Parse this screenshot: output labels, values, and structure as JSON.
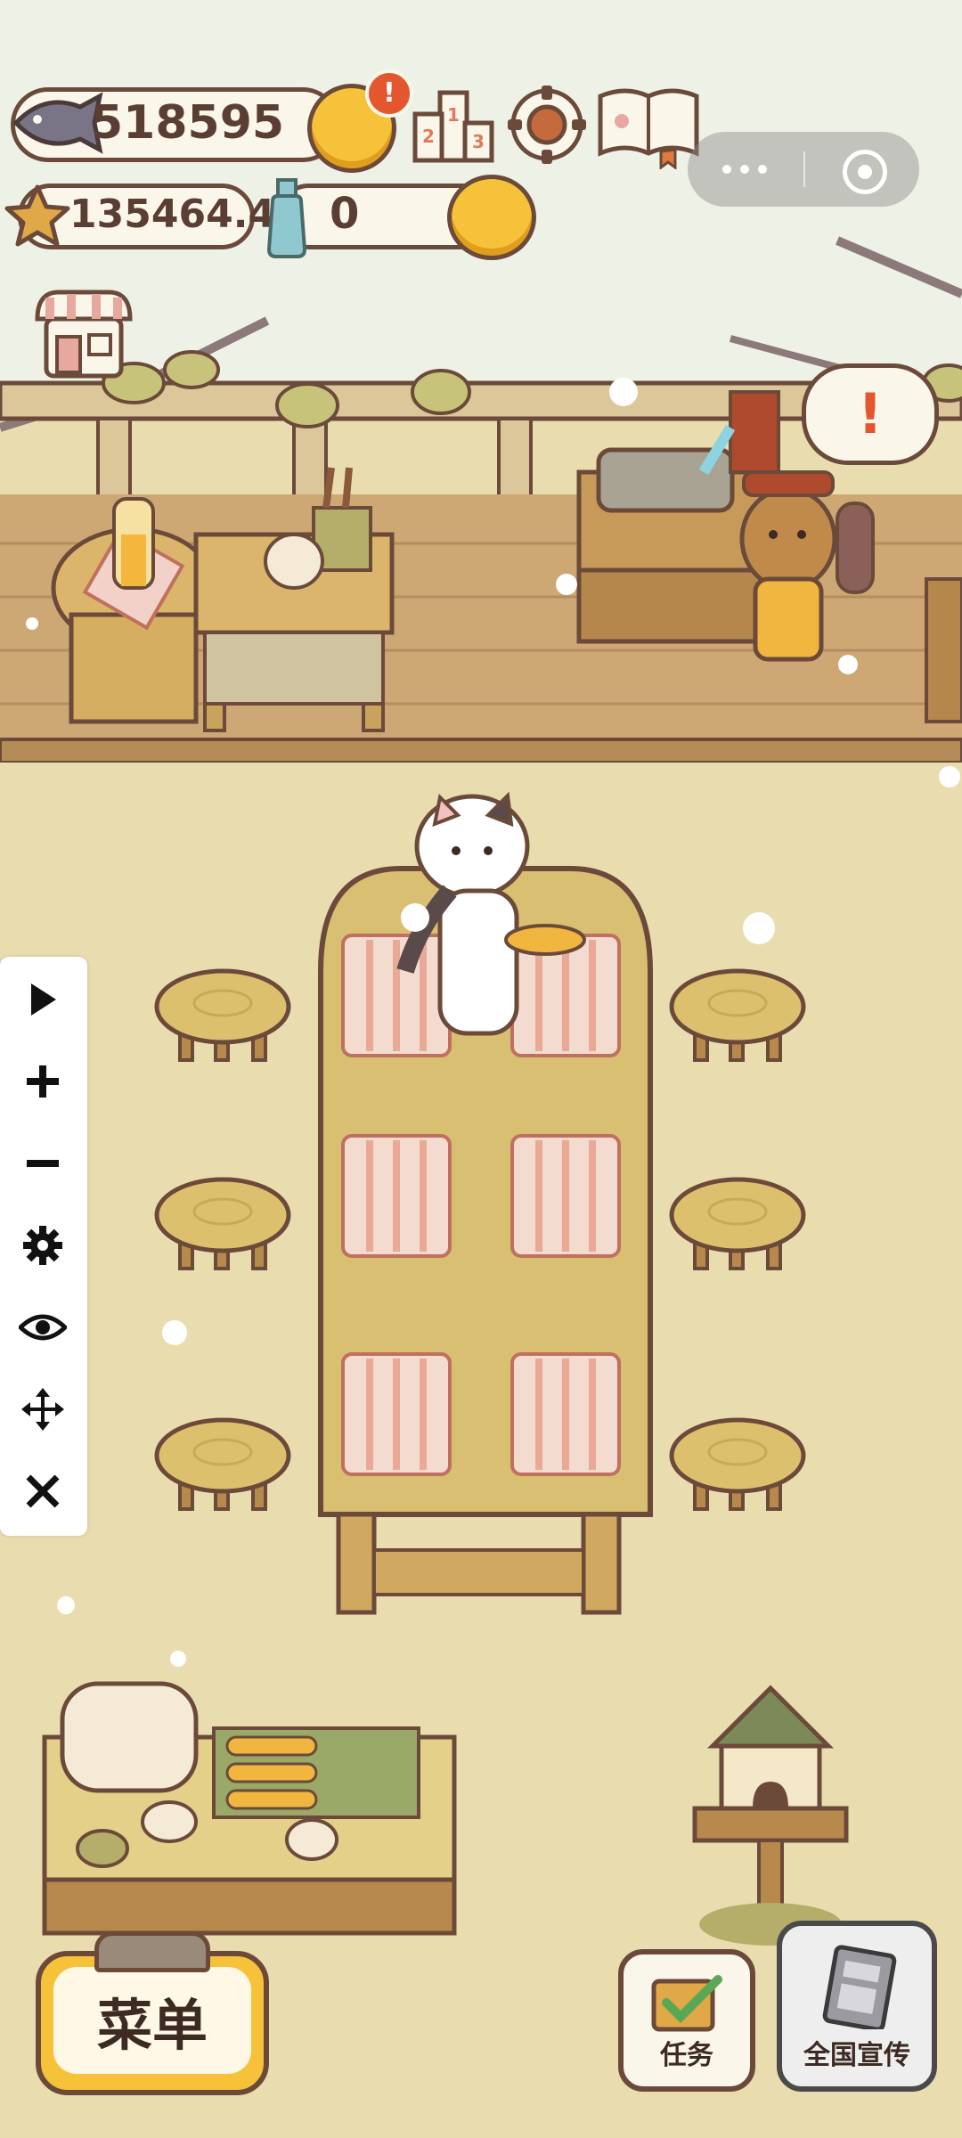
{
  "hud": {
    "fish_currency": "518595",
    "star_currency": "135464.4",
    "bottle_currency": "0",
    "notification_badge": "!"
  },
  "speech_bubble": "!",
  "side_toolbar": {
    "items": [
      "play-icon",
      "zoom-in-icon",
      "zoom-out-icon",
      "gear-icon",
      "eye-icon",
      "move-icon",
      "close-icon"
    ]
  },
  "bottom": {
    "menu_label": "菜单",
    "tasks_label": "任务",
    "promo_label": "全国宣传"
  },
  "colors": {
    "outline": "#6b4a3a",
    "sky": "#eef1e6",
    "floor": "#e9ddb0",
    "wood": "#d6b06a",
    "gold_button": "#f6c23a",
    "checker": "#e39480"
  }
}
